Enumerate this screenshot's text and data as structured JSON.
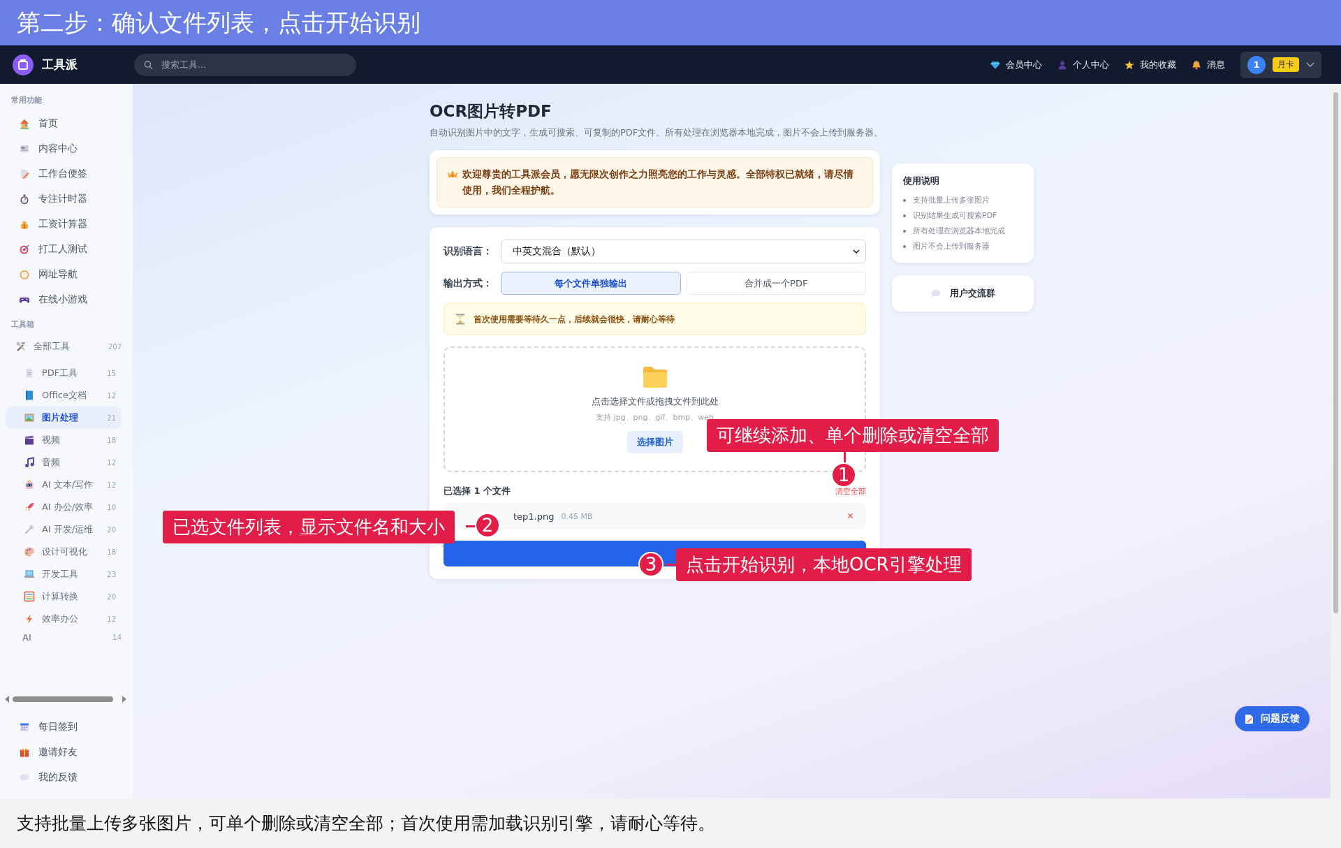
{
  "banner": {
    "title": "第二步：确认文件列表，点击开始识别"
  },
  "navbar": {
    "logo": "工具派",
    "search": {
      "placeholder": "搜索工具..."
    },
    "links": [
      {
        "label": "会员中心"
      },
      {
        "label": "个人中心"
      },
      {
        "label": "我的收藏"
      },
      {
        "label": "消息"
      }
    ],
    "user": {
      "avatar": "1",
      "badge": "月卡"
    }
  },
  "sidebar": {
    "sections": [
      {
        "title": "常用功能",
        "items": [
          {
            "label": "首页"
          },
          {
            "label": "内容中心"
          },
          {
            "label": "工作台便签"
          },
          {
            "label": "专注计时器"
          },
          {
            "label": "工资计算器"
          },
          {
            "label": "打工人测试"
          },
          {
            "label": "网址导航"
          },
          {
            "label": "在线小游戏"
          }
        ]
      },
      {
        "title": "工具箱",
        "tree": [
          {
            "label": "全部工具",
            "count": "207",
            "selected": false,
            "children": [
              {
                "label": "PDF工具",
                "count": "15",
                "selected": false
              },
              {
                "label": "Office文档",
                "count": "12",
                "selected": false
              },
              {
                "label": "图片处理",
                "count": "21",
                "selected": true
              },
              {
                "label": "视频",
                "count": "18",
                "selected": false
              },
              {
                "label": "音频",
                "count": "12",
                "selected": false
              },
              {
                "label": "AI 文本/写作",
                "count": "12",
                "selected": false
              },
              {
                "label": "AI 办公/效率",
                "count": "10",
                "selected": false
              },
              {
                "label": "AI 开发/运维",
                "count": "20",
                "selected": false
              },
              {
                "label": "设计可视化",
                "count": "18",
                "selected": false
              },
              {
                "label": "开发工具",
                "count": "23",
                "selected": false
              },
              {
                "label": "计算转换",
                "count": "20",
                "selected": false
              },
              {
                "label": "效率办公",
                "count": "12",
                "selected": false
              }
            ]
          },
          {
            "label": "AI",
            "count": "14",
            "selected": false
          }
        ]
      }
    ],
    "footer_items": [
      {
        "label": "每日签到"
      },
      {
        "label": "邀请好友"
      },
      {
        "label": "我的反馈"
      }
    ]
  },
  "page": {
    "title": "OCR图片转PDF",
    "subtitle": "自动识别图片中的文字，生成可搜索、可复制的PDF文件。所有处理在浏览器本地完成，图片不会上传到服务器。",
    "welcome": "欢迎尊贵的工具派会员，愿无限次创作之力照亮您的工作与灵感。全部特权已就绪，请尽情使用，我们全程护航。",
    "language": {
      "label": "识别语言：",
      "value": "中英文混合（默认）"
    },
    "output": {
      "label": "输出方式：",
      "options": [
        {
          "label": "每个文件单独输出",
          "selected": true
        },
        {
          "label": "合并成一个PDF",
          "selected": false
        }
      ]
    },
    "notice": "首次使用需要等待久一点，后续就会很快，请耐心等待",
    "dropzone": {
      "text": "点击选择文件或拖拽文件到此处",
      "hint": "支持 jpg、png、gif、bmp、web",
      "button": "选择图片"
    },
    "files": {
      "heading": "已选择 1 个文件",
      "clear": "清空全部",
      "items": [
        {
          "name": "tep1.png",
          "size": "0.45 MB",
          "remove": "×"
        }
      ]
    }
  },
  "help": {
    "title": "使用说明",
    "items": [
      "支持批量上传多张图片",
      "识别结果生成可搜索PDF",
      "所有处理在浏览器本地完成",
      "图片不会上传到服务器"
    ]
  },
  "group_button": "用户交流群",
  "feedback_button": "问题反馈",
  "callouts": [
    {
      "number": "1",
      "text": "可继续添加、单个删除或清空全部"
    },
    {
      "number": "2",
      "text": "已选文件列表，显示文件名和大小"
    },
    {
      "number": "3",
      "text": "点击开始识别，本地OCR引擎处理"
    }
  ],
  "caption": "支持批量上传多张图片，可单个删除或清空全部；首次使用需加载识别引擎，请耐心等待。"
}
